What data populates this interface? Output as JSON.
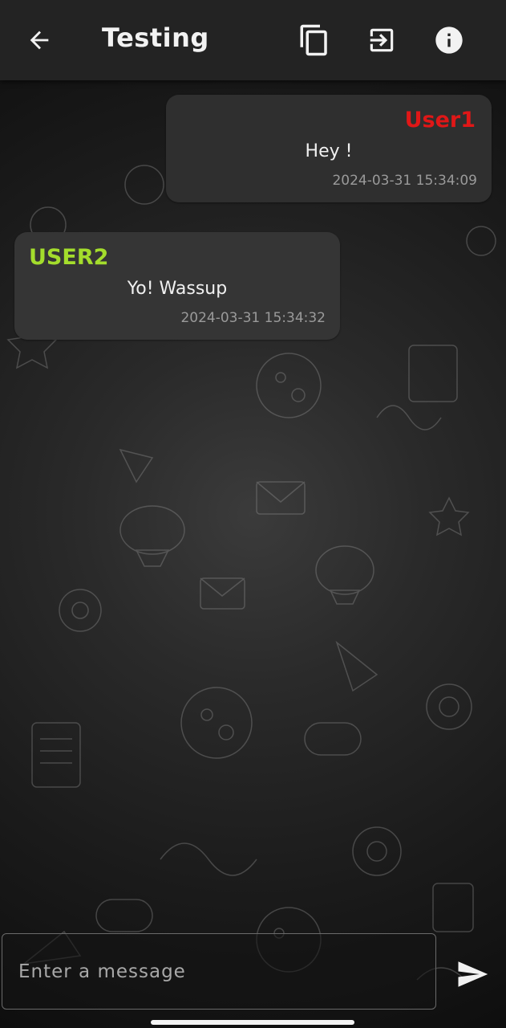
{
  "header": {
    "title": "Testing",
    "icons": {
      "back": "arrow-left-icon",
      "copy": "copy-icon",
      "exit": "exit-icon",
      "info": "info-icon"
    }
  },
  "messages": [
    {
      "sender": "User1",
      "text": "Hey !",
      "time": "2024-03-31 15:34:09",
      "sender_color": "#e01717",
      "align": "right"
    },
    {
      "sender": "USER2",
      "text": "Yo! Wassup",
      "time": "2024-03-31 15:34:32",
      "sender_color": "#a4dd2c",
      "align": "left"
    }
  ],
  "composer": {
    "placeholder": "Enter a message",
    "value": "",
    "send_icon": "send-icon"
  },
  "colors": {
    "topbar": "#232323",
    "bubble": "#2f2f2f",
    "text": "#f0f0f0",
    "timestamp": "#9a9a9a"
  }
}
